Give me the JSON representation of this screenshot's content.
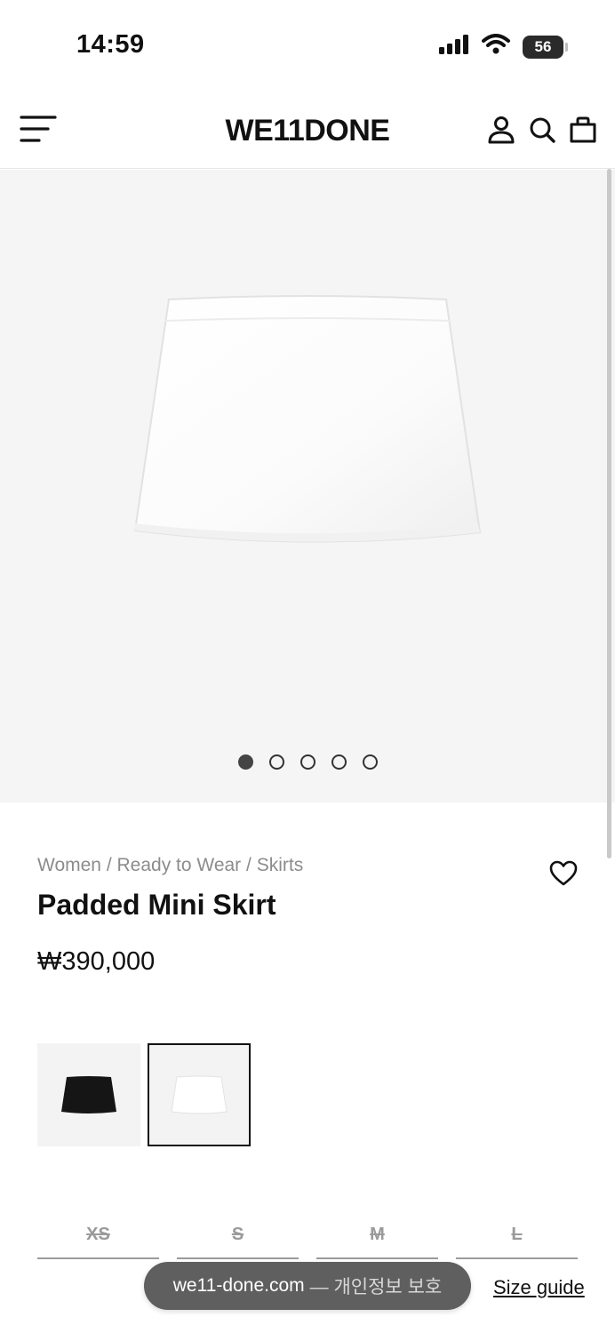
{
  "status_bar": {
    "time": "14:59",
    "battery": "56"
  },
  "nav": {
    "logo": "WE11DONE"
  },
  "gallery": {
    "image_count": 5,
    "active_index": 0
  },
  "product": {
    "breadcrumb": [
      "Women",
      "Ready to Wear",
      "Skirts"
    ],
    "breadcrumb_separator": " / ",
    "title": "Padded Mini Skirt",
    "price": "₩390,000"
  },
  "color_swatches": [
    {
      "color": "black",
      "hex": "#151515",
      "selected": false
    },
    {
      "color": "white",
      "hex": "#ffffff",
      "selected": true
    }
  ],
  "sizes": [
    {
      "label": "XS",
      "available": false
    },
    {
      "label": "S",
      "available": false
    },
    {
      "label": "M",
      "available": false
    },
    {
      "label": "L",
      "available": false
    }
  ],
  "browser": {
    "url": "we11-done.com",
    "suffix": "— 개인정보 보호"
  },
  "size_guide_label": "Size guide"
}
